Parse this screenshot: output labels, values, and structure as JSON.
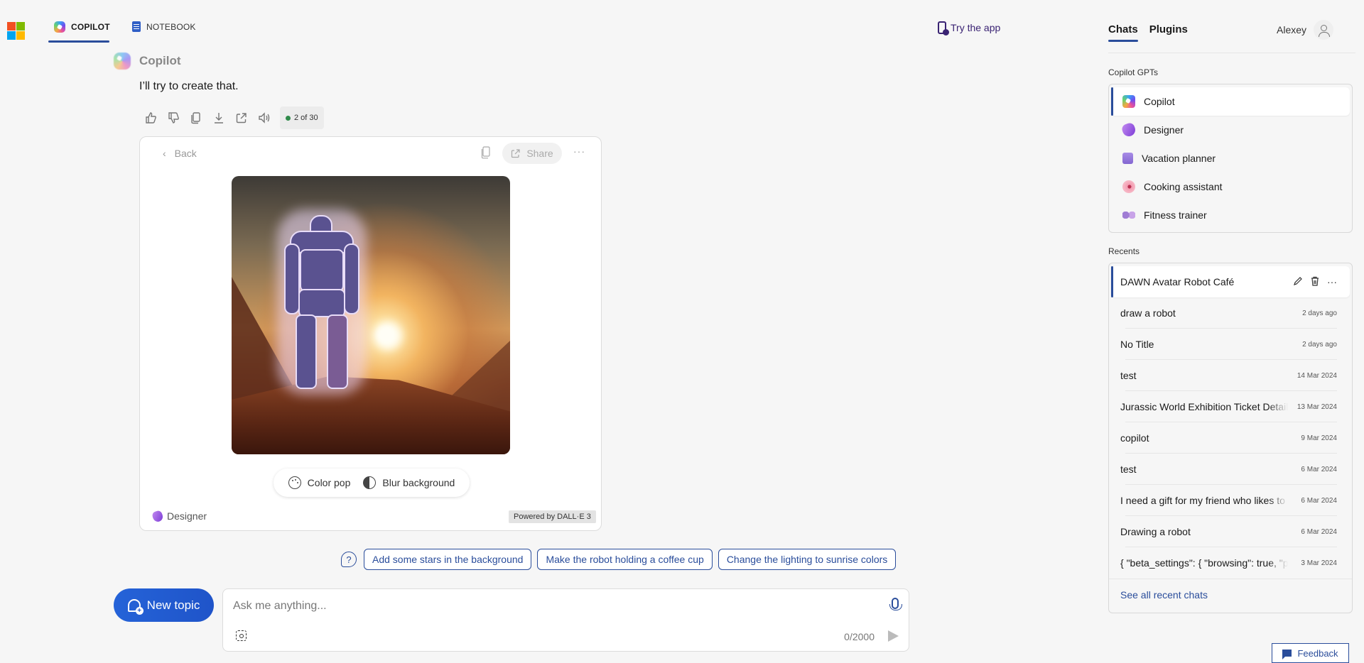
{
  "nav": {
    "tabs": [
      {
        "label": "COPILOT",
        "icon": "copilot-icon",
        "active": true
      },
      {
        "label": "NOTEBOOK",
        "icon": "notebook-icon",
        "active": false
      }
    ],
    "try_app": "Try the app"
  },
  "right_panel": {
    "tabs": [
      {
        "label": "Chats",
        "active": true
      },
      {
        "label": "Plugins",
        "active": false
      }
    ],
    "user_name": "Alexey",
    "gpts_label": "Copilot GPTs",
    "gpts": [
      {
        "label": "Copilot",
        "icon": "copilot-icon",
        "selected": true
      },
      {
        "label": "Designer",
        "icon": "designer-icon",
        "selected": false
      },
      {
        "label": "Vacation planner",
        "icon": "suitcase-icon",
        "selected": false
      },
      {
        "label": "Cooking assistant",
        "icon": "donut-icon",
        "selected": false
      },
      {
        "label": "Fitness trainer",
        "icon": "dumbbell-icon",
        "selected": false
      }
    ],
    "recents_label": "Recents",
    "recents": [
      {
        "title": "DAWN Avatar Robot Café",
        "date": "",
        "selected": true
      },
      {
        "title": "draw a robot",
        "date": "2 days ago"
      },
      {
        "title": "No Title",
        "date": "2 days ago"
      },
      {
        "title": "test",
        "date": "14 Mar 2024"
      },
      {
        "title": "Jurassic World Exhibition Ticket Details",
        "date": "13 Mar 2024"
      },
      {
        "title": "copilot",
        "date": "9 Mar 2024"
      },
      {
        "title": "test",
        "date": "6 Mar 2024"
      },
      {
        "title": "I need a gift for my friend who likes to hike",
        "date": "6 Mar 2024"
      },
      {
        "title": "Drawing a robot",
        "date": "6 Mar 2024"
      },
      {
        "title": "{ \"beta_settings\": { \"browsing\": true, \"p",
        "date": "3 Mar 2024"
      }
    ],
    "see_all": "See all recent chats",
    "feedback": "Feedback"
  },
  "chat": {
    "sender": "Copilot",
    "message": "I’ll try to create that.",
    "response_counter": "2 of 30",
    "card": {
      "back_label": "Back",
      "share_label": "Share",
      "edit_options": [
        "Color pop",
        "Blur background"
      ],
      "source_label": "Designer",
      "powered_by": "Powered by DALL·E 3"
    },
    "suggestions": [
      "Add some stars in the background",
      "Make the robot holding a coffee cup",
      "Change the lighting to sunrise colors"
    ],
    "new_topic": "New topic",
    "input": {
      "placeholder": "Ask me anything...",
      "value": "",
      "char_count": "0/2000"
    }
  },
  "colors": {
    "accent": "#2a4d9b",
    "new_topic_bg": "#2563d8",
    "status_dot": "#2f8a4a"
  }
}
